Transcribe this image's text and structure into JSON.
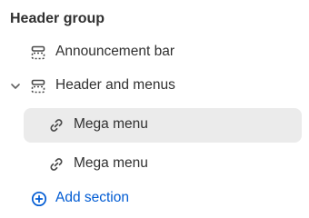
{
  "group": {
    "title": "Header group"
  },
  "items": {
    "announcement": {
      "label": "Announcement bar",
      "icon": "section-icon"
    },
    "header": {
      "label": "Header and menus",
      "icon": "section-icon",
      "expanded": true
    },
    "mega1": {
      "label": "Mega menu",
      "icon": "link-icon",
      "selected": true
    },
    "mega2": {
      "label": "Mega menu",
      "icon": "link-icon"
    }
  },
  "add_section": {
    "label": "Add section",
    "icon": "plus-circle-icon"
  },
  "colors": {
    "text": "#303030",
    "accent": "#005bd3",
    "selected_bg": "#ebebeb"
  }
}
